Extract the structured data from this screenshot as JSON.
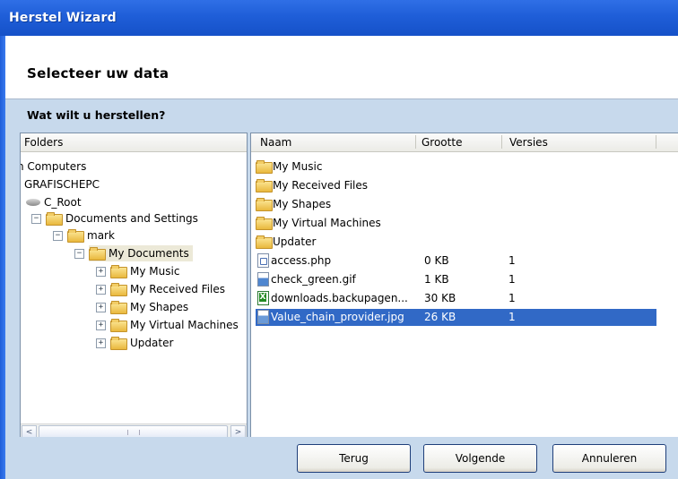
{
  "window": {
    "title": "Herstel Wizard"
  },
  "header": {
    "title": "Selecteer uw data"
  },
  "question": "Wat wilt u herstellen?",
  "folders": {
    "header": "Folders",
    "tree": [
      {
        "label": "n Computers",
        "icon": "none"
      },
      {
        "label": "GRAFISCHEPC",
        "icon": "none"
      },
      {
        "label": "C_Root",
        "icon": "drive-icon"
      },
      {
        "label": "Documents and Settings",
        "icon": "folder-icon",
        "expander": "-"
      },
      {
        "label": "mark",
        "icon": "folder-icon",
        "expander": "-"
      },
      {
        "label": "My Documents",
        "icon": "folder-icon",
        "expander": "-",
        "selected": true
      },
      {
        "label": "My Music",
        "icon": "folder-icon",
        "expander": "+"
      },
      {
        "label": "My Received Files",
        "icon": "folder-icon",
        "expander": "+"
      },
      {
        "label": "My Shapes",
        "icon": "folder-icon",
        "expander": "+"
      },
      {
        "label": "My Virtual Machines",
        "icon": "folder-icon",
        "expander": "+"
      },
      {
        "label": "Updater",
        "icon": "folder-icon",
        "expander": "+"
      }
    ],
    "scroll_left": "<",
    "scroll_right": ">"
  },
  "files": {
    "columns": [
      "Naam",
      "Grootte",
      "Versies"
    ],
    "rows": [
      {
        "name": "My Music",
        "size": "",
        "versions": "",
        "icon": "folder-icon"
      },
      {
        "name": "My Received Files",
        "size": "",
        "versions": "",
        "icon": "folder-icon"
      },
      {
        "name": "My Shapes",
        "size": "",
        "versions": "",
        "icon": "folder-icon"
      },
      {
        "name": "My Virtual Machines",
        "size": "",
        "versions": "",
        "icon": "folder-icon"
      },
      {
        "name": "Updater",
        "size": "",
        "versions": "",
        "icon": "folder-icon"
      },
      {
        "name": "access.php",
        "size": "0 KB",
        "versions": "1",
        "icon": "php-file-icon"
      },
      {
        "name": "check_green.gif",
        "size": "1 KB",
        "versions": "1",
        "icon": "image-file-icon"
      },
      {
        "name": "downloads.backupagen...",
        "size": "30 KB",
        "versions": "1",
        "icon": "excel-file-icon"
      },
      {
        "name": "Value_chain_provider.jpg",
        "size": "26 KB",
        "versions": "1",
        "icon": "image-file-icon",
        "selected": true
      }
    ]
  },
  "buttons": {
    "back": "Terug",
    "next": "Volgende",
    "cancel": "Annuleren"
  },
  "colors": {
    "title_bar": "#1f5ed8",
    "background": "#c7d9ec",
    "selection": "#3169c6"
  }
}
